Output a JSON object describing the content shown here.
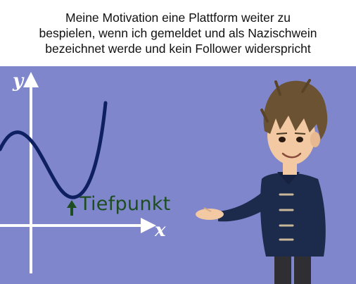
{
  "caption": {
    "text": "Meine Motivation eine Plattform weiter zu\nbespielen, wenn ich gemeldet und als Nazischwein\nbezeichnet werde und kein Follower widerspricht"
  },
  "graph": {
    "y_axis_label": "y",
    "x_axis_label": "x",
    "annotation": "Tiefpunkt",
    "colors": {
      "background": "#7f86cc",
      "axes": "#ffffff",
      "curve": "#0e2060",
      "annotation": "#1e4d22"
    }
  },
  "character": {
    "description_icon": "cartoon-teacher-presenting",
    "colors": {
      "hair": "#6b5233",
      "skin": "#f2c9a2",
      "coat": "#1c2a4c",
      "pants": "#2e2e33"
    }
  }
}
